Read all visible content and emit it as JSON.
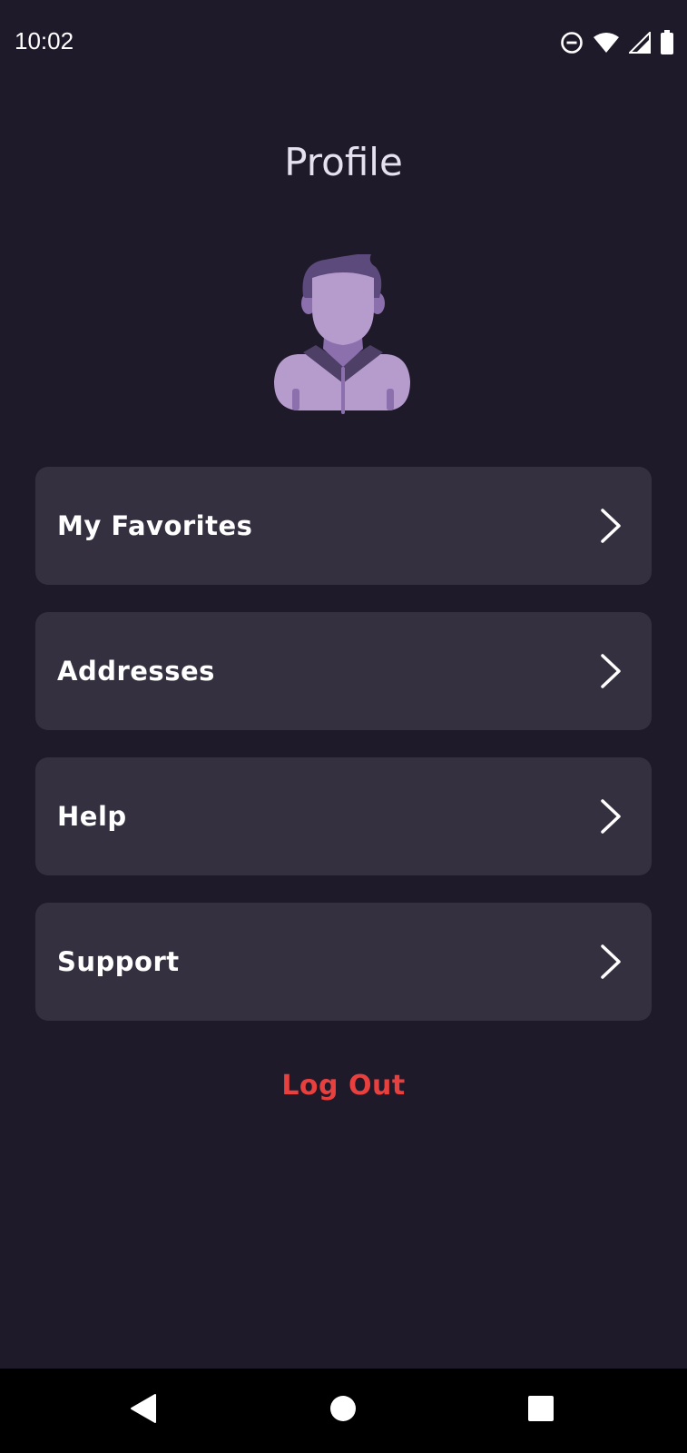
{
  "status_bar": {
    "time": "10:02",
    "icons": [
      "do-not-disturb-icon",
      "wifi-icon",
      "signal-icon",
      "battery-icon"
    ]
  },
  "header": {
    "title": "Profile"
  },
  "avatar": {
    "icon": "user-avatar-icon",
    "colors": {
      "hair": "#5c4a7c",
      "skin": "#b69ccd",
      "collar": "#4d3f66",
      "neck": "#8c70ad"
    }
  },
  "menu": {
    "items": [
      {
        "label": "My Favorites",
        "icon": "chevron-right-icon"
      },
      {
        "label": "Addresses",
        "icon": "chevron-right-icon"
      },
      {
        "label": "Help",
        "icon": "chevron-right-icon"
      },
      {
        "label": "Support",
        "icon": "chevron-right-icon"
      }
    ]
  },
  "logout": {
    "label": "Log Out",
    "color": "#e8403e"
  },
  "nav_bar": {
    "buttons": [
      "back-icon",
      "home-icon",
      "recents-icon"
    ]
  },
  "colors": {
    "background": "#1e1a2a",
    "card": "#353040",
    "text": "#ffffff",
    "accent": "#e8403e"
  }
}
